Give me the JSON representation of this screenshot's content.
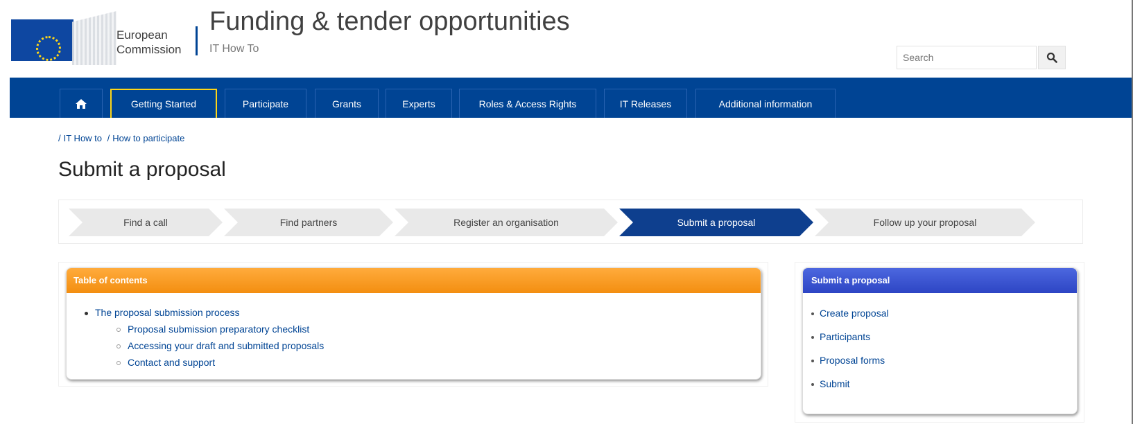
{
  "header": {
    "org_line1": "European",
    "org_line2": "Commission",
    "site_title": "Funding & tender opportunities",
    "site_subtitle": "IT How To",
    "search_placeholder": "Search",
    "search_icon": "magnifier-icon"
  },
  "nav": {
    "home_icon": "home-icon",
    "items": [
      {
        "label": "Getting Started",
        "active": true
      },
      {
        "label": "Participate"
      },
      {
        "label": "Grants"
      },
      {
        "label": "Experts"
      },
      {
        "label": "Roles & Access Rights"
      },
      {
        "label": "IT Releases"
      },
      {
        "label": "Additional information"
      }
    ]
  },
  "breadcrumb": {
    "sep": "/",
    "items": [
      "IT How to",
      "How to participate"
    ]
  },
  "page": {
    "title": "Submit a proposal"
  },
  "steps": [
    {
      "label": "Find a call"
    },
    {
      "label": "Find partners"
    },
    {
      "label": "Register an organisation"
    },
    {
      "label": "Submit a proposal",
      "active": true
    },
    {
      "label": "Follow up your proposal"
    }
  ],
  "toc": {
    "heading": "Table of contents",
    "main_item": "The proposal submission process",
    "sub_items": [
      "Proposal submission preparatory checklist",
      "Accessing your draft and submitted proposals",
      "Contact and support"
    ]
  },
  "side": {
    "heading": "Submit a proposal",
    "items": [
      "Create proposal",
      "Participants",
      "Proposal forms",
      "Submit"
    ]
  },
  "colors": {
    "brand_blue": "#004494",
    "accent_yellow": "#ffd617",
    "toc_orange": "#f38e10",
    "side_blue": "#2d45c4"
  }
}
